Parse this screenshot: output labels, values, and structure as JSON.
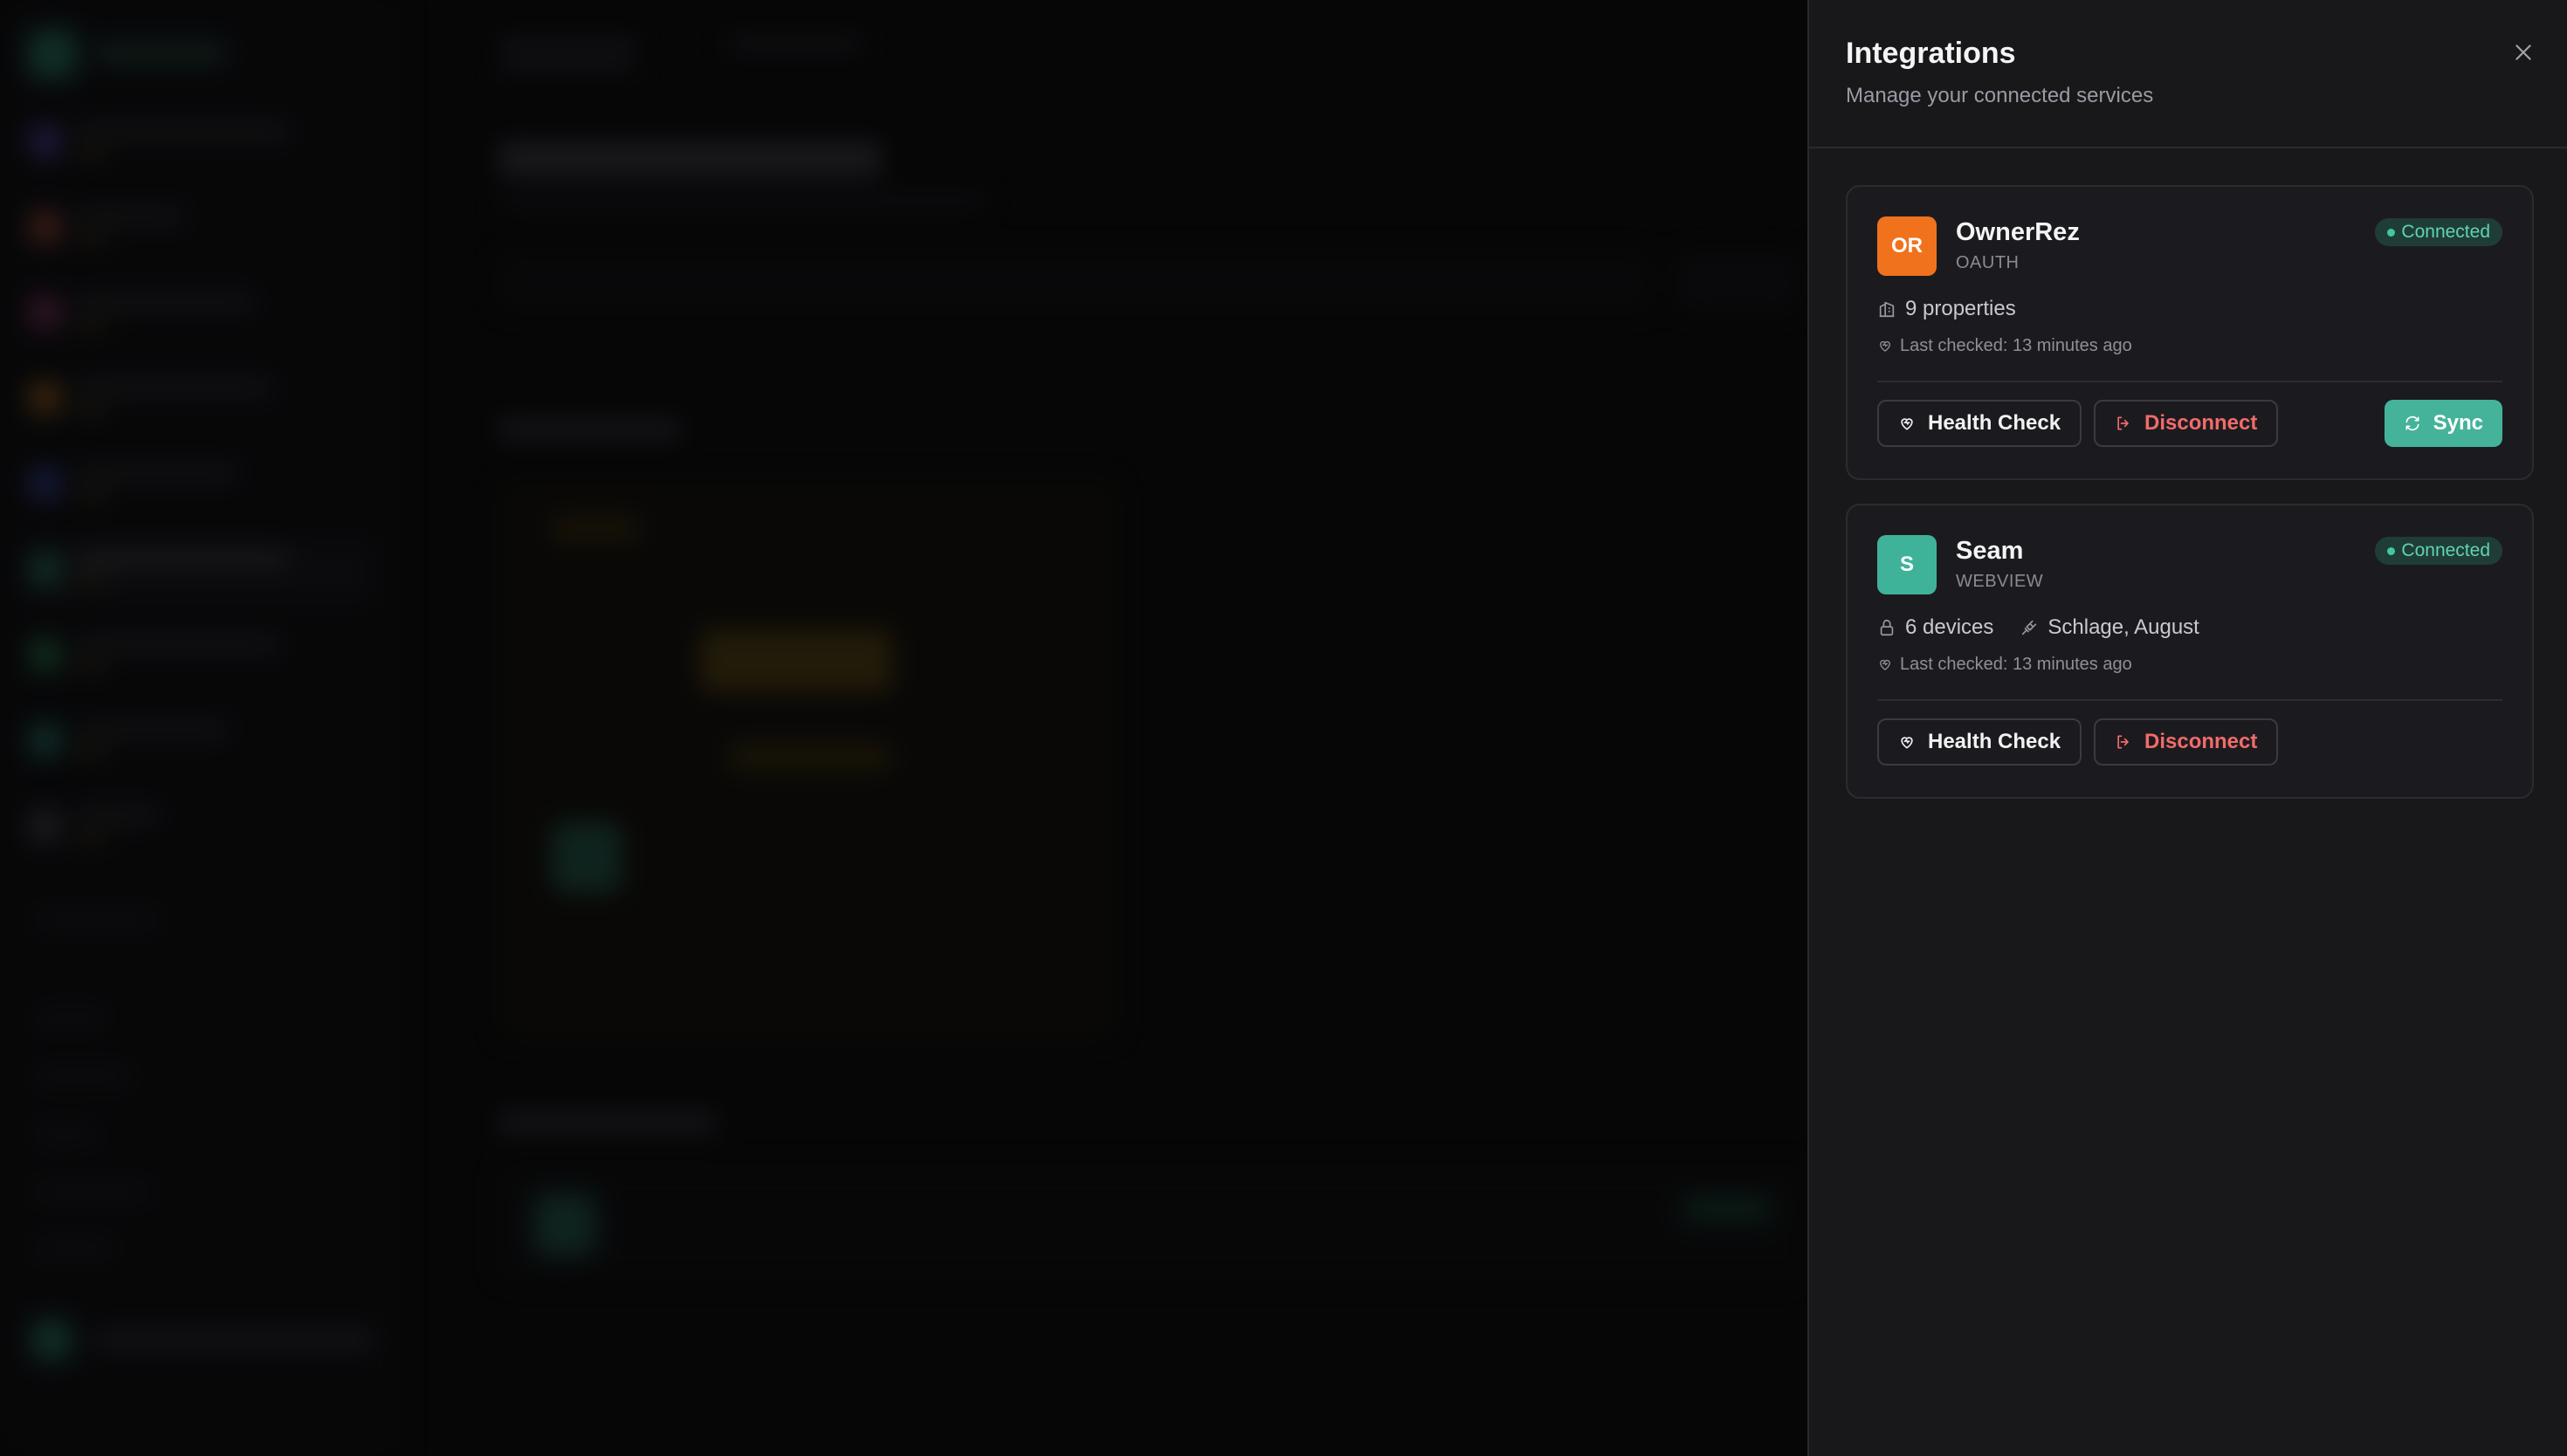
{
  "panel": {
    "title": "Integrations",
    "subtitle": "Manage your connected services"
  },
  "integrations": [
    {
      "avatar_text": "OR",
      "avatar_color": "#f0721c",
      "name": "OwnerRez",
      "type": "OAUTH",
      "status": "Connected",
      "meta": [
        {
          "icon": "building-icon",
          "text": "9 properties"
        }
      ],
      "last_checked": "Last checked: 13 minutes ago",
      "actions": {
        "health_check": "Health Check",
        "disconnect": "Disconnect",
        "sync": "Sync"
      }
    },
    {
      "avatar_text": "S",
      "avatar_color": "#3fb39a",
      "name": "Seam",
      "type": "WEBVIEW",
      "status": "Connected",
      "meta": [
        {
          "icon": "lock-icon",
          "text": "6 devices"
        },
        {
          "icon": "plug-icon",
          "text": "Schlage, August"
        }
      ],
      "last_checked": "Last checked: 13 minutes ago",
      "actions": {
        "health_check": "Health Check",
        "disconnect": "Disconnect"
      }
    }
  ],
  "colors": {
    "accent": "#45b39a",
    "danger": "#f26b6b",
    "status_connected": "#5fd3b6",
    "panel_bg": "#18181b"
  }
}
